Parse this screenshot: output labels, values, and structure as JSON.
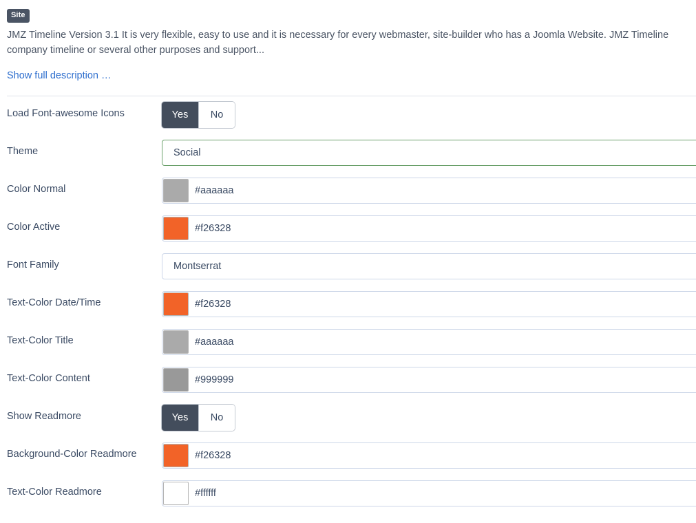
{
  "description": {
    "badge": "Site",
    "text": "JMZ Timeline Version 3.1 It is very flexible, easy to use and it is necessary for every webmaster, site-builder who has a Joomla Website. JMZ Timeline company timeline or several other purposes and support...",
    "show_full_link": "Show full description …"
  },
  "toggle_options": {
    "yes": "Yes",
    "no": "No"
  },
  "colors": {
    "badge_bg": "#4a5464",
    "toggle_active_bg": "#434d5c",
    "label_text": "#3a4a63",
    "link": "#2f6fce",
    "field_border": "#ccd6e8",
    "field_border_focus": "#6aa06a",
    "orange": "#f26328",
    "gray_aaa": "#aaaaaa",
    "gray_999": "#999999",
    "white": "#ffffff"
  },
  "fields": [
    {
      "label": "Load Font-awesome Icons",
      "type": "toggle",
      "selected": "Yes"
    },
    {
      "label": "Theme",
      "type": "text",
      "value": "Social",
      "focused": true
    },
    {
      "label": "Color Normal",
      "type": "color",
      "value": "#aaaaaa",
      "swatch": "#aaaaaa"
    },
    {
      "label": "Color Active",
      "type": "color",
      "value": "#f26328",
      "swatch": "#f26328"
    },
    {
      "label": "Font Family",
      "type": "text",
      "value": "Montserrat",
      "focused": false
    },
    {
      "label": "Text-Color Date/Time",
      "type": "color",
      "value": "#f26328",
      "swatch": "#f26328"
    },
    {
      "label": "Text-Color Title",
      "type": "color",
      "value": "#aaaaaa",
      "swatch": "#aaaaaa"
    },
    {
      "label": "Text-Color Content",
      "type": "color",
      "value": "#999999",
      "swatch": "#999999"
    },
    {
      "label": "Show Readmore",
      "type": "toggle",
      "selected": "Yes"
    },
    {
      "label": "Background-Color Readmore",
      "type": "color",
      "value": "#f26328",
      "swatch": "#f26328"
    },
    {
      "label": "Text-Color Readmore",
      "type": "color",
      "value": "#ffffff",
      "swatch": "#ffffff"
    }
  ]
}
